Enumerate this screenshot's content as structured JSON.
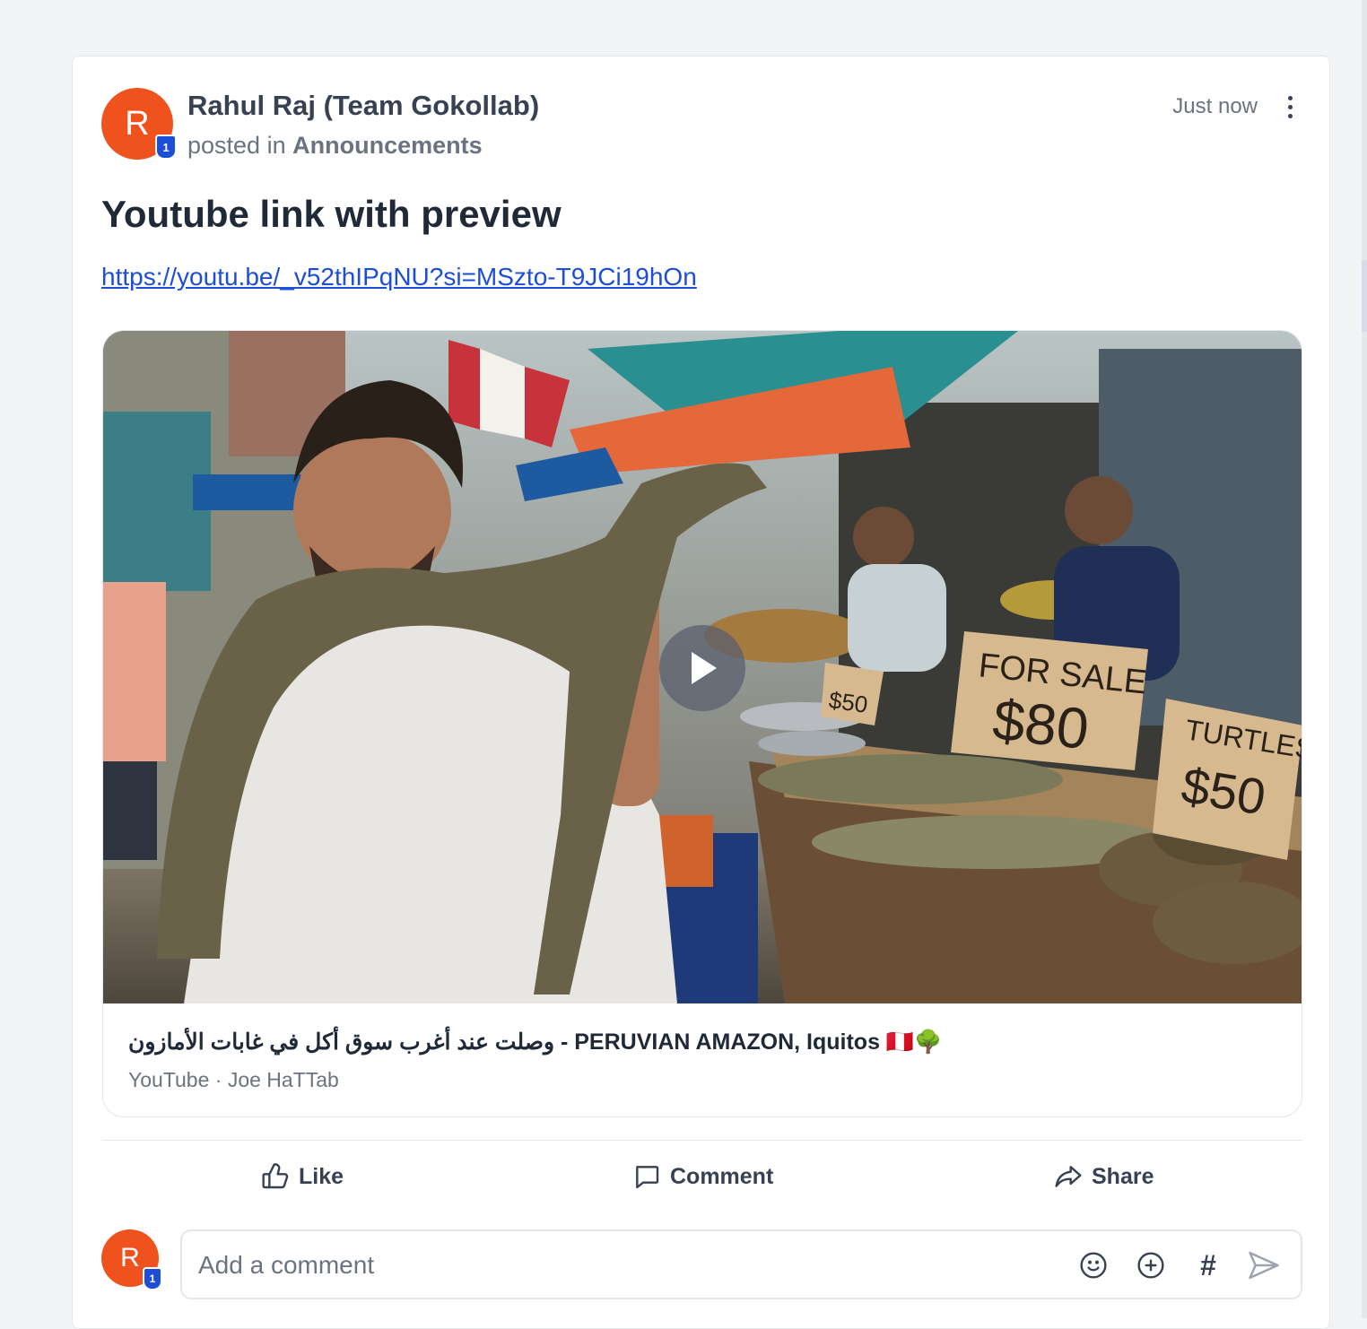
{
  "post": {
    "author_initial": "R",
    "author_badge": "1",
    "author_name": "Rahul Raj (Team Gokollab)",
    "posted_in_prefix": "posted in",
    "channel": "Announcements",
    "timestamp": "Just now",
    "title": "Youtube link with preview",
    "link": "https://youtu.be/_v52thIPqNU?si=MSzto-T9JCi19hOn"
  },
  "preview": {
    "title": "وصلت عند أغرب سوق أكل في غابات الأمازون - PERUVIAN AMAZON, Iquitos 🇵🇪🌳",
    "source": "YouTube · Joe HaTTab",
    "sign_for_sale": "FOR SALE",
    "sign_price_80": "$80",
    "sign_turtles": "TURTLES",
    "sign_price_50": "$50",
    "sign_small": "$50"
  },
  "actions": {
    "like": "Like",
    "comment": "Comment",
    "share": "Share"
  },
  "composer": {
    "avatar_initial": "R",
    "avatar_badge": "1",
    "placeholder": "Add a comment",
    "hashtag": "#"
  },
  "colors": {
    "avatar": "#f0521e",
    "badge": "#1d4ed8",
    "link": "#1d4ed8"
  },
  "icons": {
    "more": "more-vertical-icon",
    "play": "play-icon",
    "like": "thumbs-up-icon",
    "comment": "speech-bubble-icon",
    "share": "share-arrow-icon",
    "emoji": "smiley-icon",
    "attach": "plus-circle-icon",
    "send": "send-icon"
  }
}
